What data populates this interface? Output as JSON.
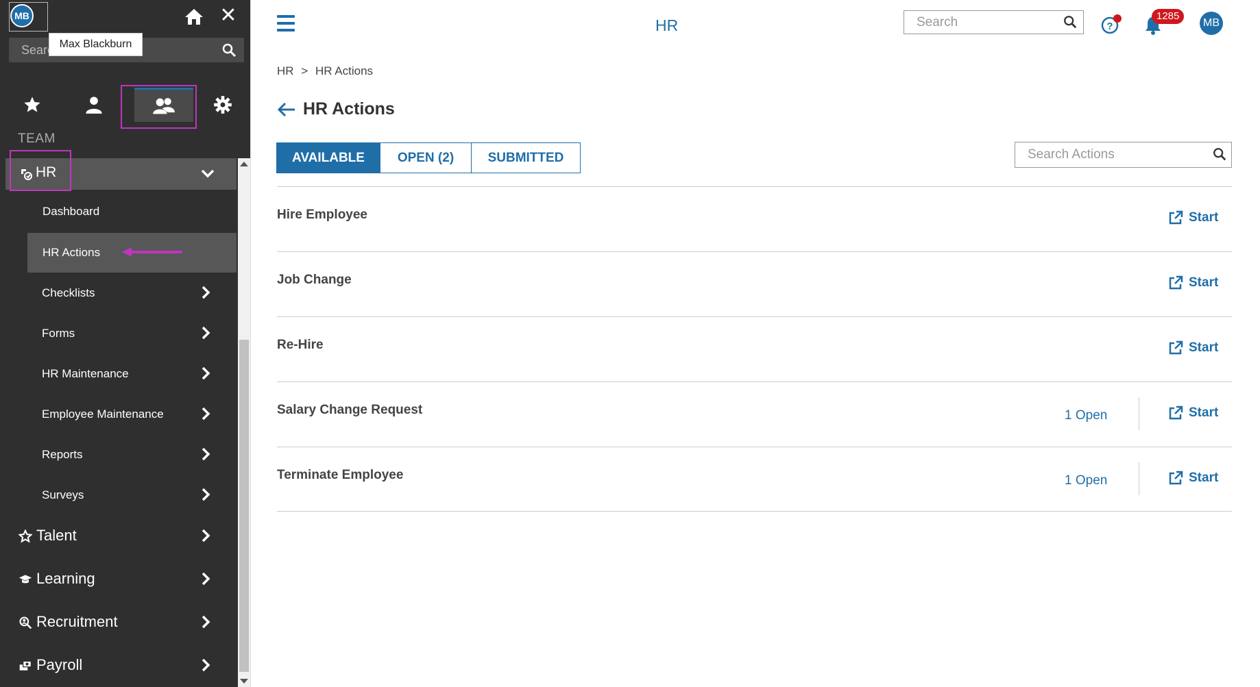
{
  "user": {
    "initials": "MB",
    "tooltip": "Max Blackburn"
  },
  "sidebar": {
    "search_placeholder": "Search",
    "section_label": "TEAM",
    "open_menu": {
      "label": "HR"
    },
    "sub_items": [
      {
        "label": "Dashboard",
        "active": false
      },
      {
        "label": "HR Actions",
        "active": true
      }
    ],
    "child_items": [
      {
        "label": "Checklists"
      },
      {
        "label": "Forms"
      },
      {
        "label": "HR Maintenance"
      },
      {
        "label": "Employee Maintenance"
      },
      {
        "label": "Reports"
      },
      {
        "label": "Surveys"
      }
    ],
    "top_items": [
      {
        "label": "Talent",
        "icon": "star-outline-icon"
      },
      {
        "label": "Learning",
        "icon": "graduation-cap-icon"
      },
      {
        "label": "Recruitment",
        "icon": "search-person-icon"
      },
      {
        "label": "Payroll",
        "icon": "money-icon"
      }
    ],
    "tabs": [
      "favorites-icon",
      "my-profile-icon",
      "team-icon",
      "settings-icon"
    ]
  },
  "header": {
    "title": "HR",
    "search_placeholder": "Search",
    "notification_count": "1285",
    "avatar_initials": "MB"
  },
  "breadcrumb": {
    "root": "HR",
    "separator": ">",
    "current": "HR Actions"
  },
  "page": {
    "title": "HR Actions",
    "tabs": [
      {
        "label": "AVAILABLE",
        "active": true
      },
      {
        "label": "OPEN (2)",
        "active": false
      },
      {
        "label": "SUBMITTED",
        "active": false
      }
    ],
    "actions_search_placeholder": "Search Actions",
    "start_label": "Start",
    "actions": [
      {
        "name": "Hire Employee",
        "open": ""
      },
      {
        "name": "Job Change",
        "open": ""
      },
      {
        "name": "Re-Hire",
        "open": ""
      },
      {
        "name": "Salary Change Request",
        "open": "1 Open"
      },
      {
        "name": "Terminate Employee",
        "open": "1 Open"
      }
    ]
  },
  "colors": {
    "accent": "#1f6ea8",
    "sidebar_bg": "#2f2f2f",
    "highlight": "#c035c0",
    "badge": "#d0171d"
  }
}
